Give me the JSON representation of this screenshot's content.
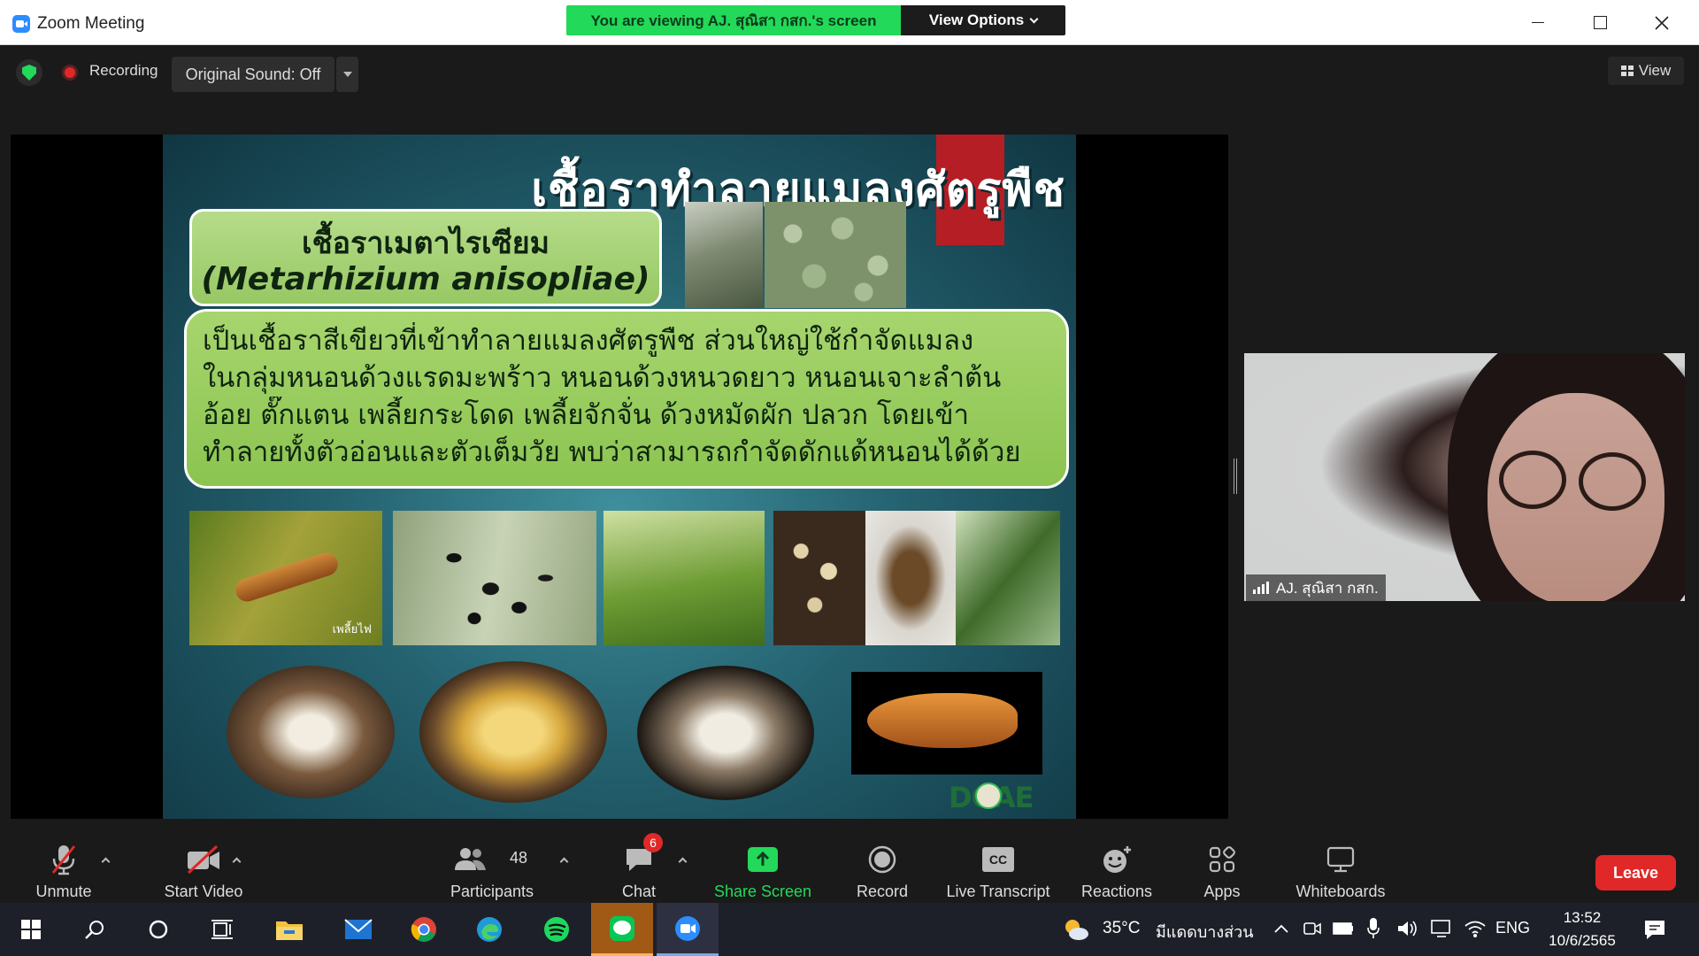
{
  "window": {
    "title": "Zoom Meeting"
  },
  "banner": {
    "viewing_text": "You are viewing AJ. สุณิสา กสก.'s screen",
    "view_options": "View Options"
  },
  "top": {
    "recording": "Recording",
    "original_sound": "Original Sound: Off",
    "view": "View"
  },
  "slide": {
    "title": "เชื้อราทำลายแมลงศัตรูพืช",
    "fungus_thai": "เชื้อราเมตาไรเซียม",
    "fungus_scientific": "(Metarhizium anisopliae)",
    "description_lines": [
      "เป็นเชื้อราสีเขียวที่เข้าทำลายแมลงศัตรูพืช ส่วนใหญ่ใช้กำจัดแมลง",
      "ในกลุ่มหนอนด้วงแรดมะพร้าว หนอนด้วงหนวดยาว หนอนเจาะลำต้น",
      "อ้อย ตั๊กแตน เพลี้ยกระโดด เพลี้ยจักจั่น ด้วงหมัดผัก ปลวก โดยเข้า",
      "ทำลายทั้งตัวอ่อนและตัวเต็มวัย พบว่าสามารถกำจัดดักแด้หนอนได้ด้วย"
    ],
    "photo_caption": "เพลี้ยไฟ",
    "logo_text": "DOAE",
    "accent_color": "#b51e24"
  },
  "participant": {
    "name": "AJ. สุณิสา กสก."
  },
  "toolbar": {
    "unmute": "Unmute",
    "start_video": "Start Video",
    "participants": "Participants",
    "participants_count": "48",
    "chat": "Chat",
    "chat_badge": "6",
    "share_screen": "Share Screen",
    "record": "Record",
    "live_transcript": "Live Transcript",
    "reactions": "Reactions",
    "apps": "Apps",
    "whiteboards": "Whiteboards",
    "leave": "Leave",
    "cc": "CC"
  },
  "taskbar": {
    "weather_temp": "35°C",
    "weather_desc": "มีแดดบางส่วน",
    "lang": "ENG",
    "time": "13:52",
    "date": "10/6/2565"
  },
  "colors": {
    "share_green": "#23d959",
    "leave_red": "#e02828"
  }
}
